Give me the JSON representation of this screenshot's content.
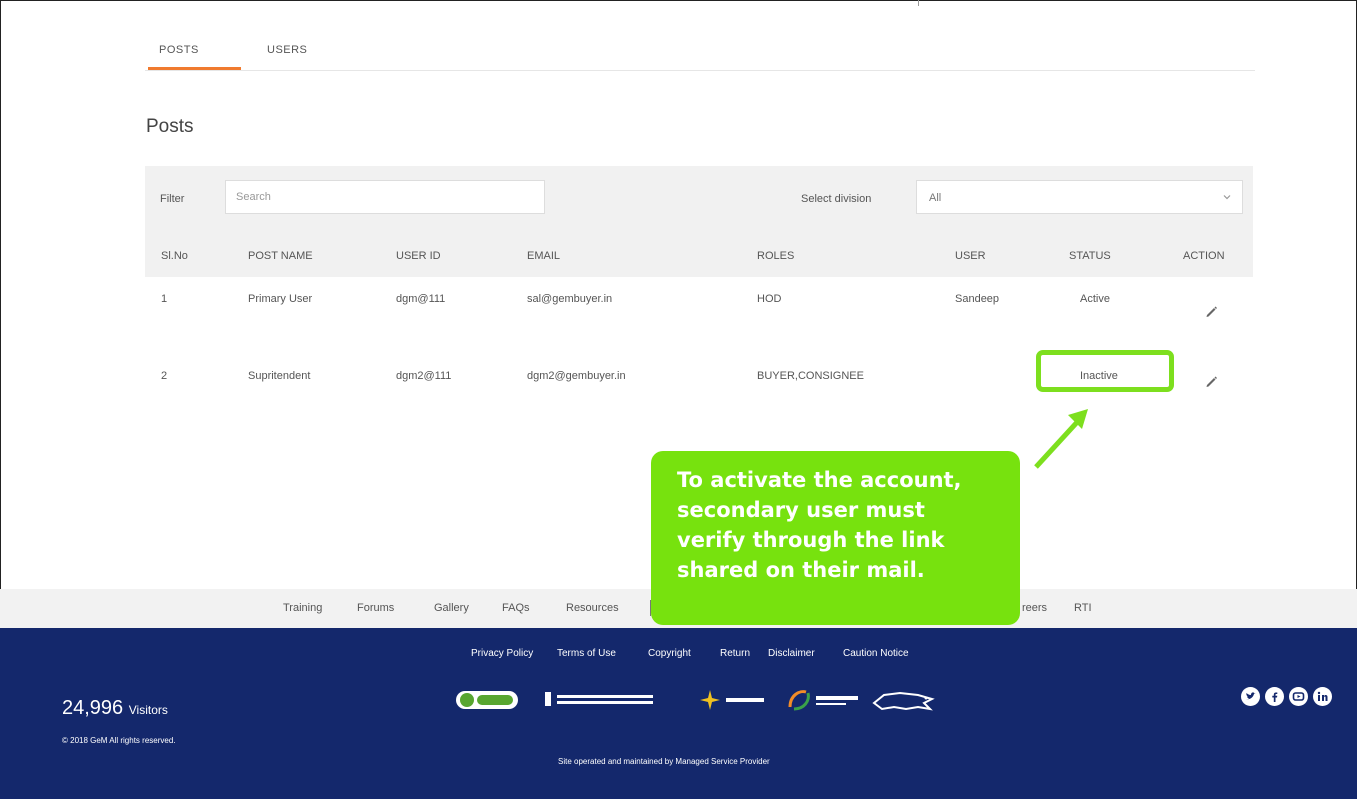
{
  "tabs": [
    {
      "label": "POSTS",
      "active": true
    },
    {
      "label": "USERS",
      "active": false
    }
  ],
  "page_title": "Posts",
  "filter": {
    "label": "Filter",
    "search_placeholder": "Search",
    "division_label": "Select division",
    "division_value": "All"
  },
  "table": {
    "headers": [
      "Sl.No",
      "POST NAME",
      "USER ID",
      "EMAIL",
      "ROLES",
      "USER",
      "STATUS",
      "ACTION"
    ],
    "rows": [
      {
        "sl": "1",
        "post_name": "Primary User",
        "user_id": "dgm@111",
        "email": "sal@gembuyer.in",
        "roles": "HOD",
        "user": "Sandeep",
        "status": "Active"
      },
      {
        "sl": "2",
        "post_name": "Supritendent",
        "user_id": "dgm2@111",
        "email": "dgm2@gembuyer.in",
        "roles": "BUYER,CONSIGNEE",
        "user": "",
        "status": "Inactive"
      }
    ]
  },
  "callout": {
    "text": "To activate the account,\nsecondary user must\nverify through the link\nshared on their mail."
  },
  "footer": {
    "links": [
      "Training",
      "Forums",
      "Gallery",
      "FAQs",
      "Resources",
      "reers",
      "RTI"
    ],
    "legal_links": [
      "Privacy Policy",
      "Terms of Use",
      "Copyright",
      "Return",
      "Disclaimer",
      "Caution Notice"
    ],
    "visitors_count": "24,996",
    "visitors_label": "Visitors",
    "copyright": "© 2018 GeM All rights reserved.",
    "maintained": "Site operated and maintained by Managed Service Provider",
    "logos": [
      "secure-badge-logo",
      "department-of-commerce-logo",
      "gem-spv-logo",
      "digital-india-logo",
      "make-in-india-logo"
    ],
    "social_icons": [
      "twitter-icon",
      "facebook-icon",
      "youtube-icon",
      "linkedin-icon"
    ]
  },
  "colors": {
    "accent_tab": "#f07a2e",
    "highlight_green": "#7ddf1e",
    "callout_green": "#77e20e",
    "footer_navy": "#14286c"
  }
}
